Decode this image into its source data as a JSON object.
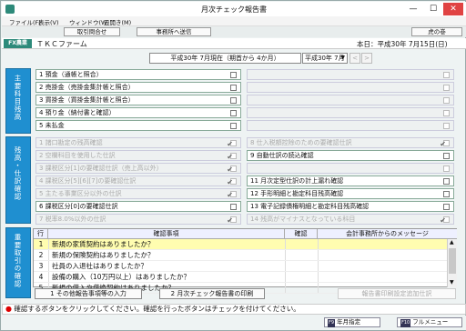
{
  "window": {
    "title": "月次チェック報告書",
    "minimize": "—",
    "maximize": "☐",
    "close": "✕"
  },
  "menu": {
    "file": "ファイル(F)",
    "view": "表示(V)",
    "window": "ウィンドウ(W)",
    "monthly": "五開き(M)"
  },
  "toolbar": {
    "inquiry": "取引問合せ",
    "send": "事務所へ送信",
    "tora": "虎の巻"
  },
  "header": {
    "badge": "FX農業",
    "company": "ＴＫＣファーム",
    "date": "本日：平成30年 7月15日(日)"
  },
  "period": {
    "label": "平成30年 7月現在（期首から 4か月）",
    "select_value": "平成30年 7月",
    "prev": "<",
    "next": ">"
  },
  "sections": {
    "balance": "主要科目残高",
    "checks": "残高・仕訳確認",
    "important": "重要取引の確認"
  },
  "balance_items": [
    {
      "label": "1 預金（通帳と照合）"
    },
    {
      "label": "2 売掛金（売掛金集計帳と照合）"
    },
    {
      "label": "3 買掛金（買掛金集計帳と照合）"
    },
    {
      "label": "4 預り金（納付書と確認）"
    },
    {
      "label": "5 未払金"
    }
  ],
  "check_left": [
    {
      "label": "1 諸口勘定の残高確認",
      "checked": true
    },
    {
      "label": "2 空欄科目を使用した仕訳",
      "checked": true
    },
    {
      "label": "3 課税区分[1]の要確認仕訳（売上高以外）",
      "checked": true
    },
    {
      "label": "4 課税区分[5][6][7]の要確認仕訳",
      "checked": true
    },
    {
      "label": "5 主たる事業区分以外の仕訳",
      "checked": true
    },
    {
      "label": "6 課税区分[0]の要確認仕訳",
      "checked": false
    },
    {
      "label": "7 税率8.0%以外の仕訳",
      "checked": true
    }
  ],
  "check_right": [
    {
      "label": "8 仕入税額控除のための要確認仕訳",
      "checked": true
    },
    {
      "label": "9 自動仕訳の読込確認",
      "checked": false
    },
    {
      "label": "",
      "checked": false
    },
    {
      "label": "11 月次定型仕訳の計上漏れ確認",
      "checked": false
    },
    {
      "label": "12 手形明細と勘定科目残高確認",
      "checked": false
    },
    {
      "label": "13 電子記録債権明細と勘定科目残高確認",
      "checked": false
    },
    {
      "label": "14 残高がマイナスとなっている科目",
      "checked": true
    }
  ],
  "grid": {
    "headers": {
      "no": "行",
      "item": "確認事項",
      "confirm": "確認",
      "message": "会計事務所からのメッセージ"
    },
    "rows": [
      {
        "no": "1",
        "text": "新規の家賃契約はありましたか？"
      },
      {
        "no": "2",
        "text": "新規の保険契約はありましたか？"
      },
      {
        "no": "3",
        "text": "社員の入退社はありましたか？"
      },
      {
        "no": "4",
        "text": "設備の購入（10万円以上）はありましたか？"
      },
      {
        "no": "5",
        "text": "新規の借入や借換契約はありましたか？"
      }
    ]
  },
  "buttons": {
    "other": "1 その他報告事項等の入力",
    "print": "2 月次チェック報告書の印刷",
    "addprint": "報告書印刷設定追加仕訳"
  },
  "status": {
    "text": "確認するボタンをクリックしてください。確認を行ったボタンはチェックを付けてください。"
  },
  "footer": {
    "f9": "F9",
    "f9_label": "年月指定",
    "f10": "F10",
    "f10_label": "フルメニュー"
  }
}
